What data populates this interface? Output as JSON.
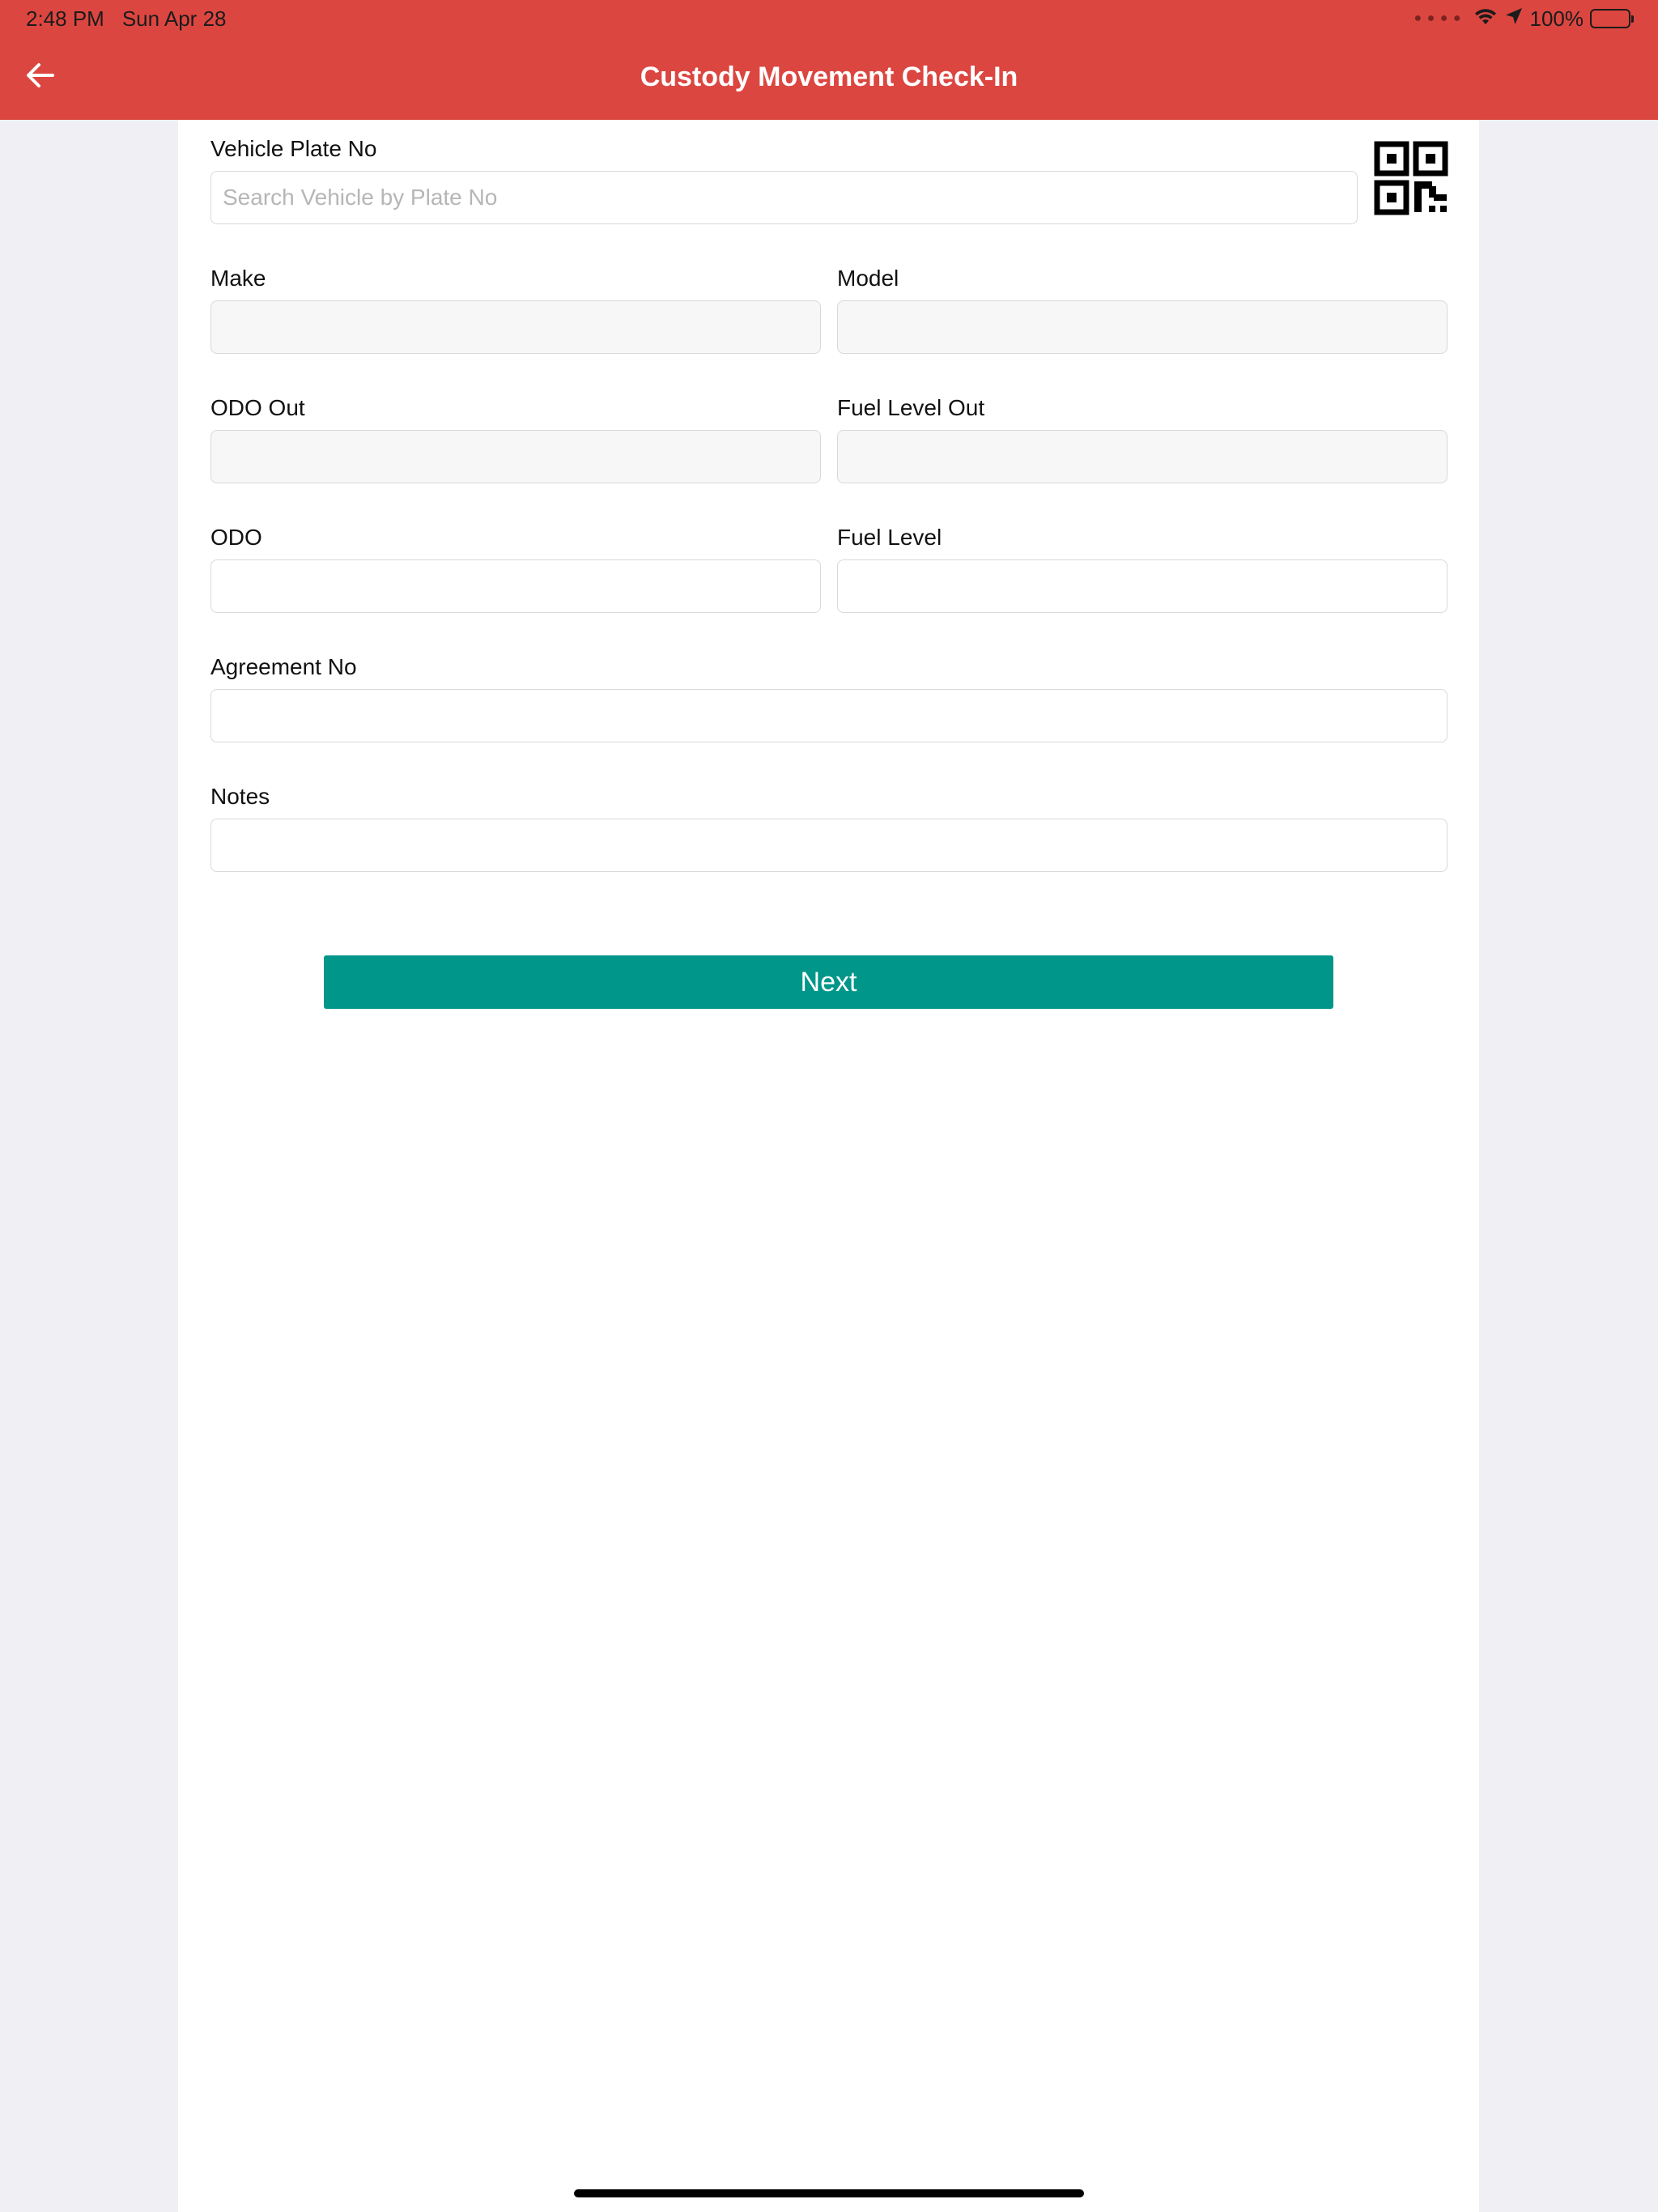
{
  "status_bar": {
    "time": "2:48 PM",
    "date": "Sun Apr 28",
    "battery": "100%",
    "battery_level": 1.0
  },
  "header": {
    "title": "Custody Movement Check-In",
    "back_icon": "arrow-left-icon",
    "color": "#dc4640"
  },
  "form": {
    "vehicle_plate": {
      "label": "Vehicle Plate No",
      "placeholder": "Search Vehicle by Plate No",
      "value": "",
      "scan_icon": "qr-code-icon"
    },
    "make": {
      "label": "Make",
      "value": ""
    },
    "model": {
      "label": "Model",
      "value": ""
    },
    "odo_out": {
      "label": "ODO Out",
      "value": ""
    },
    "fuel_level_out": {
      "label": "Fuel Level Out",
      "value": ""
    },
    "odo": {
      "label": "ODO",
      "value": ""
    },
    "fuel_level": {
      "label": "Fuel Level",
      "value": ""
    },
    "agreement_no": {
      "label": "Agreement No",
      "value": ""
    },
    "notes": {
      "label": "Notes",
      "value": ""
    }
  },
  "actions": {
    "next_label": "Next",
    "next_color": "#00968a"
  }
}
